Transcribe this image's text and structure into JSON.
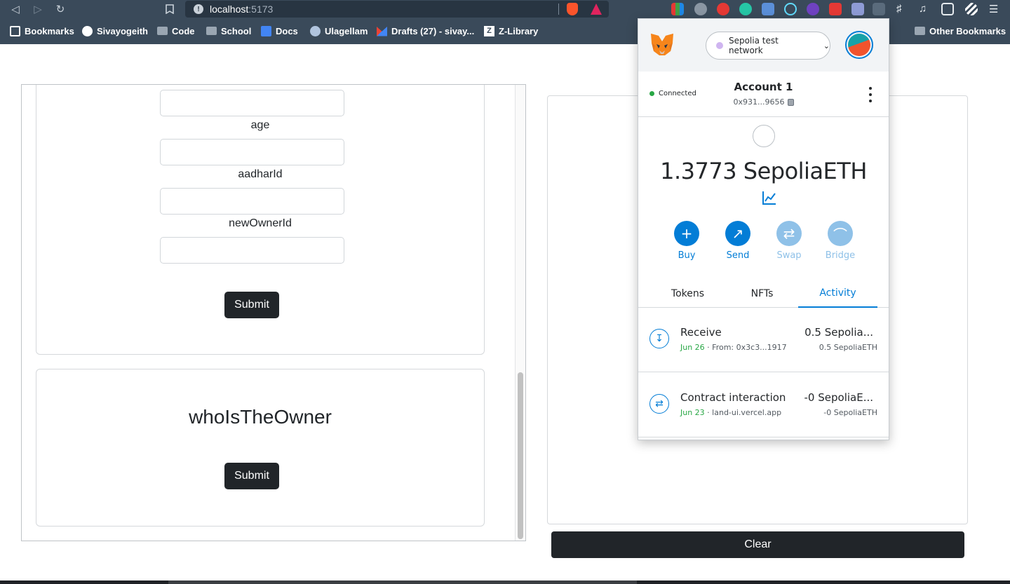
{
  "browser": {
    "url_host": "localhost",
    "url_port": ":5173",
    "bookmarks": [
      {
        "label": "Bookmarks"
      },
      {
        "label": "Sivayogeith"
      },
      {
        "label": "Code"
      },
      {
        "label": "School"
      },
      {
        "label": "Docs"
      },
      {
        "label": "Ulagellam"
      },
      {
        "label": "Drafts (27) - sivay..."
      },
      {
        "label": "Z-Library"
      },
      {
        "label": "Other Bookmarks"
      }
    ]
  },
  "form": {
    "labels": [
      "age",
      "aadharId",
      "newOwnerId"
    ],
    "submit_label": "Submit"
  },
  "owner_card": {
    "title": "whoIsTheOwner",
    "submit_label": "Submit"
  },
  "output": {
    "clear_label": "Clear"
  },
  "metamask": {
    "network": "Sepolia test network",
    "status": "Connected",
    "account_name": "Account 1",
    "address": "0x931...9656",
    "balance": "1.3773 SepoliaETH",
    "actions": [
      {
        "label": "Buy",
        "enabled": true
      },
      {
        "label": "Send",
        "enabled": true
      },
      {
        "label": "Swap",
        "enabled": false
      },
      {
        "label": "Bridge",
        "enabled": false
      }
    ],
    "tabs": [
      "Tokens",
      "NFTs",
      "Activity"
    ],
    "active_tab": "Activity",
    "transactions": [
      {
        "title": "Receive",
        "date": "Jun 26",
        "detail": " · From: 0x3c3...1917",
        "amount": "0.5 Sepolia...",
        "amount_sub": "0.5 SepoliaETH"
      },
      {
        "title": "Contract interaction",
        "date": "Jun 23",
        "detail": " · land-ui.vercel.app",
        "amount": "-0 SepoliaE...",
        "amount_sub": "-0 SepoliaETH"
      }
    ],
    "colors": {
      "primary": "#037dd6",
      "success": "#28a745"
    }
  }
}
